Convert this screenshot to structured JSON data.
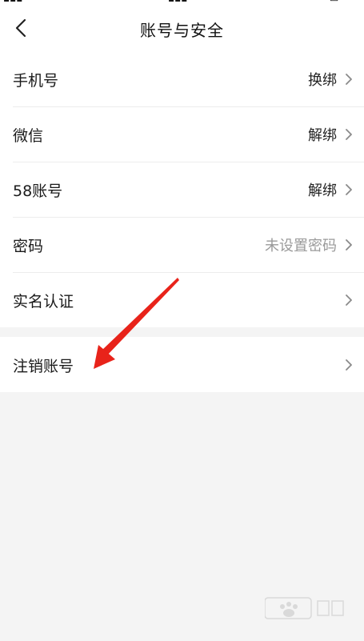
{
  "header": {
    "title": "账号与安全"
  },
  "settings": {
    "rows": [
      {
        "label": "手机号",
        "value": "换绑"
      },
      {
        "label": "微信",
        "value": "解绑"
      },
      {
        "label": "58账号",
        "value": "解绑"
      },
      {
        "label": "密码",
        "value": "未设置密码"
      },
      {
        "label": "实名认证",
        "value": ""
      }
    ],
    "cancel_row": {
      "label": "注销账号"
    }
  },
  "colors": {
    "background": "#f4f4f4",
    "surface": "#ffffff",
    "annotation_arrow": "#e8231a",
    "muted_text": "#9a9a9a"
  },
  "icons": {
    "back": "chevron-left-icon",
    "row_chevron": "chevron-right-icon"
  }
}
